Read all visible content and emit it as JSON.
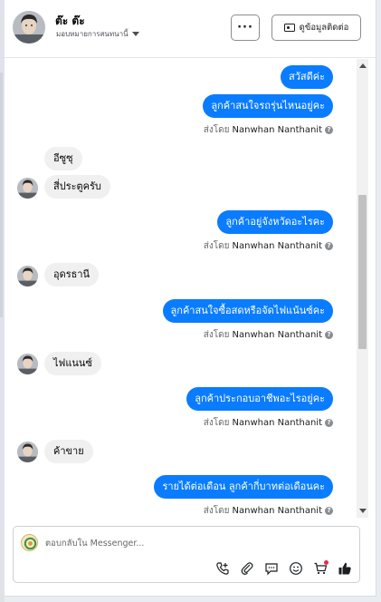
{
  "header": {
    "name": "ต๊ะ ต๊ะ",
    "assign_label": "มอบหมายการสนทนานี้",
    "more_label": "···",
    "contact_label": "ดูข้อมูลติดต่อ"
  },
  "messages": {
    "out_1": "สวัสดีค่ะ",
    "out_2": "ลูกค้าสนใจรถรุ่นไหนอยู่คะ",
    "in_1": "อีซูซุ",
    "in_2": "สี่ประตูครับ",
    "out_3": "ลูกค้าอยู่จังหวัดอะไรคะ",
    "in_3": "อุดรธานี",
    "out_4": "ลูกค้าสนใจซื้อสดหรือจัดไฟแน้นซ์คะ",
    "in_4": "ไฟแนนซ์",
    "out_5": "ลูกค้าประกอบอาชีพอะไรอยู่คะ",
    "in_5": "ค้าขาย",
    "out_6": "รายได้ต่อเดือน ลูกค้ากี่บาทต่อเดือนคะ"
  },
  "sent_by": {
    "prefix": "ส่งโดย",
    "name": "Nanwhan Nanthanit",
    "help": "?"
  },
  "composer": {
    "placeholder": "ตอบกลับใน Messenger...",
    "value": ""
  },
  "icons": {
    "more": "more-icon",
    "contact": "contact-card-icon",
    "call": "add-call-icon",
    "attach": "paperclip-icon",
    "saved_replies": "chat-bubbles-icon",
    "emoji": "emoji-icon",
    "shop": "shopping-cart-icon",
    "like": "thumbs-up-icon"
  },
  "colors": {
    "outgoing_bubble": "#0a7cff",
    "incoming_bubble": "#f0f0f0",
    "notification_dot": "#f02849"
  }
}
